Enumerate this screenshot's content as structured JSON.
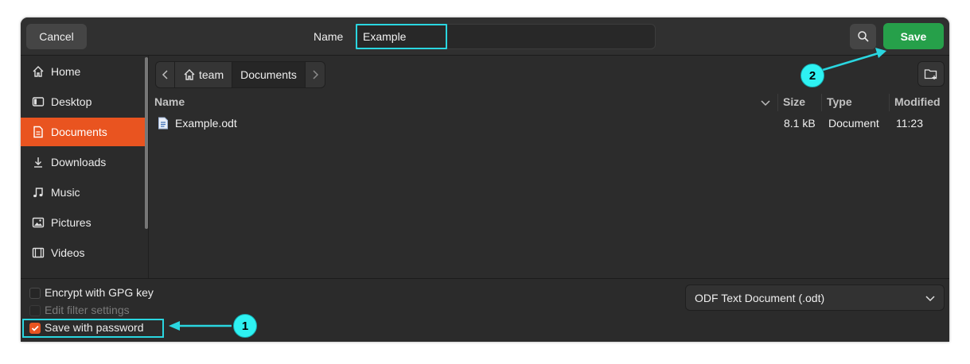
{
  "header": {
    "cancel_label": "Cancel",
    "name_label": "Name",
    "name_value": "Example",
    "save_label": "Save"
  },
  "sidebar": {
    "items": [
      {
        "label": "Home",
        "icon": "home-icon"
      },
      {
        "label": "Desktop",
        "icon": "desktop-icon"
      },
      {
        "label": "Documents",
        "icon": "document-icon",
        "active": true
      },
      {
        "label": "Downloads",
        "icon": "download-icon"
      },
      {
        "label": "Music",
        "icon": "music-icon"
      },
      {
        "label": "Pictures",
        "icon": "picture-icon"
      },
      {
        "label": "Videos",
        "icon": "video-icon"
      }
    ]
  },
  "pathbar": {
    "segments": [
      "team",
      "Documents"
    ]
  },
  "table": {
    "columns": [
      "Name",
      "Size",
      "Type",
      "Modified"
    ],
    "rows": [
      {
        "name": "Example.odt",
        "size": "8.1 kB",
        "type": "Document",
        "modified": "11:23"
      }
    ]
  },
  "options": {
    "encrypt_label": "Encrypt with GPG key",
    "edit_filter_label": "Edit filter settings",
    "save_password_label": "Save with password"
  },
  "filter": {
    "selected": "ODF Text Document (.odt)"
  },
  "annotations": {
    "marker_1": "1",
    "marker_2": "2"
  },
  "colors": {
    "accent": "#e95420",
    "save_button": "#26a04a",
    "highlight": "#2ad6e0"
  }
}
